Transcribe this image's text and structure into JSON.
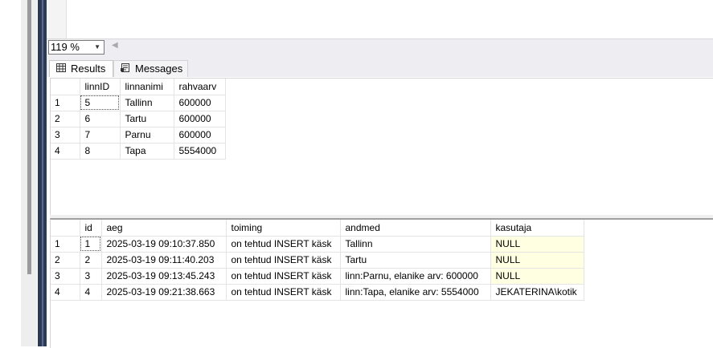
{
  "zoom": {
    "value": "119 %"
  },
  "tabs": [
    {
      "label": "Results",
      "icon": "grid-icon"
    },
    {
      "label": "Messages",
      "icon": "messages-icon"
    }
  ],
  "grid1": {
    "columns": [
      "linnID",
      "linnanimi",
      "rahvaarv"
    ],
    "rows": [
      {
        "n": "1",
        "cells": [
          "5",
          "Tallinn",
          "600000"
        ]
      },
      {
        "n": "2",
        "cells": [
          "6",
          "Tartu",
          "600000"
        ]
      },
      {
        "n": "3",
        "cells": [
          "7",
          "Parnu",
          "600000"
        ]
      },
      {
        "n": "4",
        "cells": [
          "8",
          "Tapa",
          "5554000"
        ]
      }
    ]
  },
  "grid2": {
    "columns": [
      "id",
      "aeg",
      "toiming",
      "andmed",
      "kasutaja"
    ],
    "rows": [
      {
        "n": "1",
        "cells": [
          "1",
          "2025-03-19 09:10:37.850",
          "on tehtud INSERT käsk",
          "Tallinn",
          "NULL"
        ]
      },
      {
        "n": "2",
        "cells": [
          "2",
          "2025-03-19 09:11:40.203",
          "on tehtud INSERT käsk",
          "Tartu",
          "NULL"
        ]
      },
      {
        "n": "3",
        "cells": [
          "3",
          "2025-03-19 09:13:45.243",
          "on tehtud INSERT käsk",
          "linn:Parnu, elanike arv: 600000",
          "NULL"
        ]
      },
      {
        "n": "4",
        "cells": [
          "4",
          "2025-03-19 09:21:38.663",
          "on tehtud INSERT käsk",
          "linn:Tapa, elanike arv: 5554000",
          "JEKATERINA\\kotik"
        ]
      }
    ]
  },
  "colors": {
    "null_bg": "#ffffe1",
    "editor_border": "#2c3a55"
  }
}
